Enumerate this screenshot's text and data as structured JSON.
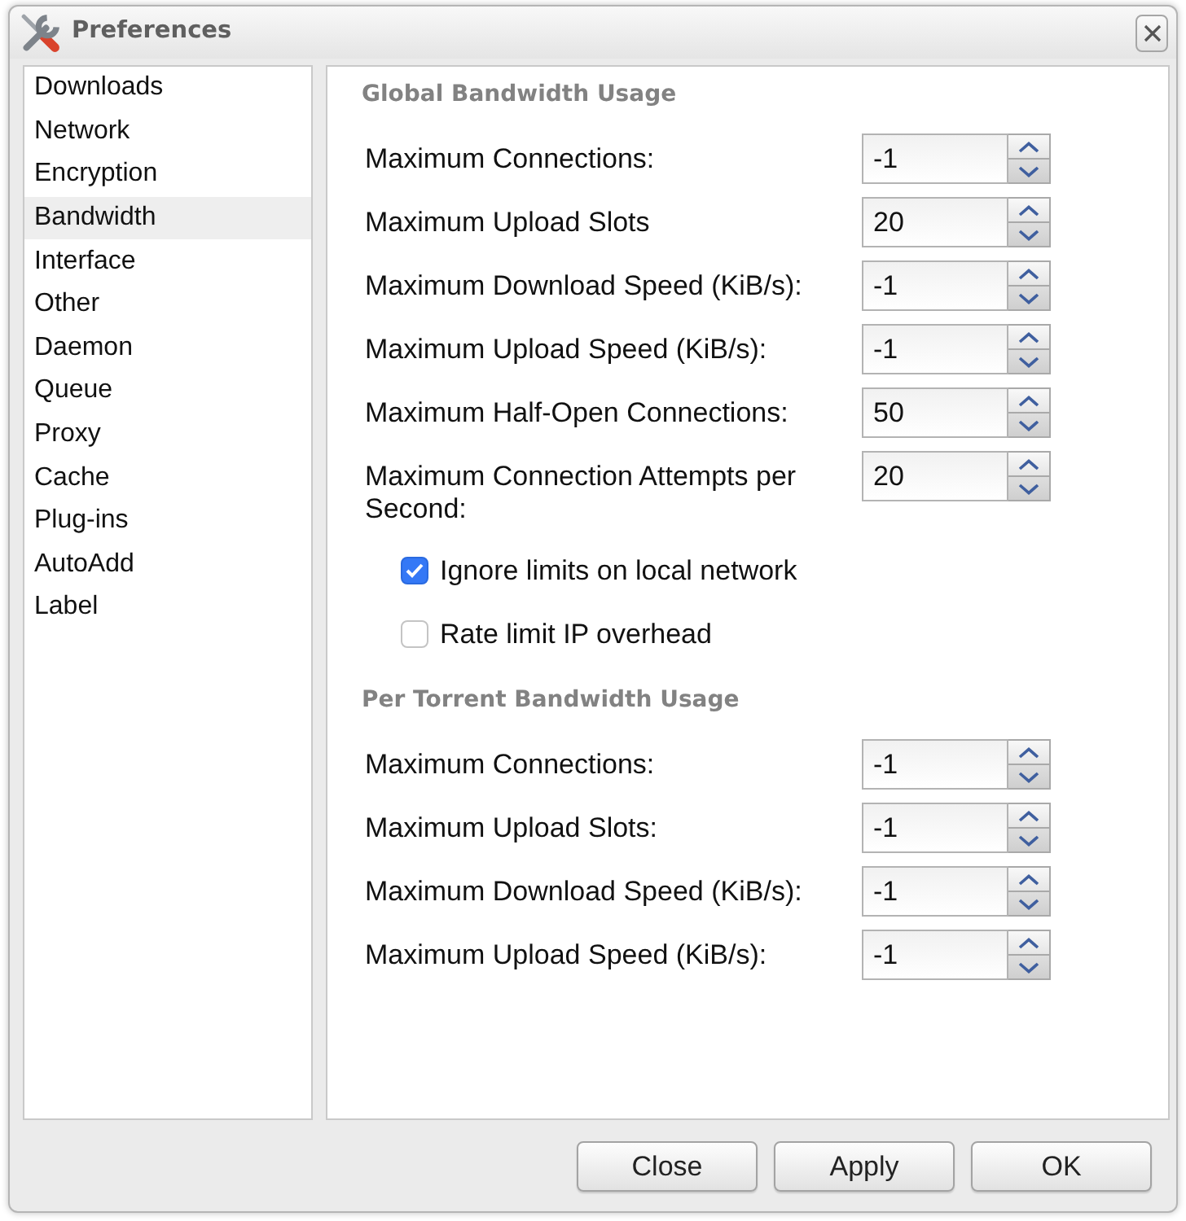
{
  "window": {
    "title": "Preferences"
  },
  "sidebar": {
    "items": [
      {
        "label": "Downloads",
        "selected": false
      },
      {
        "label": "Network",
        "selected": false
      },
      {
        "label": "Encryption",
        "selected": false
      },
      {
        "label": "Bandwidth",
        "selected": true
      },
      {
        "label": "Interface",
        "selected": false
      },
      {
        "label": "Other",
        "selected": false
      },
      {
        "label": "Daemon",
        "selected": false
      },
      {
        "label": "Queue",
        "selected": false
      },
      {
        "label": "Proxy",
        "selected": false
      },
      {
        "label": "Cache",
        "selected": false
      },
      {
        "label": "Plug-ins",
        "selected": false
      },
      {
        "label": "AutoAdd",
        "selected": false
      },
      {
        "label": "Label",
        "selected": false
      }
    ]
  },
  "sections": [
    {
      "heading": "Global Bandwidth Usage",
      "fields": [
        {
          "label": "Maximum Connections:",
          "value": "-1"
        },
        {
          "label": "Maximum Upload Slots",
          "value": "20"
        },
        {
          "label": "Maximum Download Speed (KiB/s):",
          "value": "-1"
        },
        {
          "label": "Maximum Upload Speed (KiB/s):",
          "value": "-1"
        },
        {
          "label": "Maximum Half-Open Connections:",
          "value": "50"
        },
        {
          "label": "Maximum Connection Attempts per Second:",
          "value": "20"
        }
      ],
      "checkboxes": [
        {
          "label": "Ignore limits on local network",
          "checked": true
        },
        {
          "label": "Rate limit IP overhead",
          "checked": false
        }
      ]
    },
    {
      "heading": "Per Torrent Bandwidth Usage",
      "fields": [
        {
          "label": "Maximum Connections:",
          "value": "-1"
        },
        {
          "label": "Maximum Upload Slots:",
          "value": "-1"
        },
        {
          "label": "Maximum Download Speed (KiB/s):",
          "value": "-1"
        },
        {
          "label": "Maximum Upload Speed (KiB/s):",
          "value": "-1"
        }
      ]
    }
  ],
  "buttons": [
    "Close",
    "Apply",
    "OK"
  ]
}
